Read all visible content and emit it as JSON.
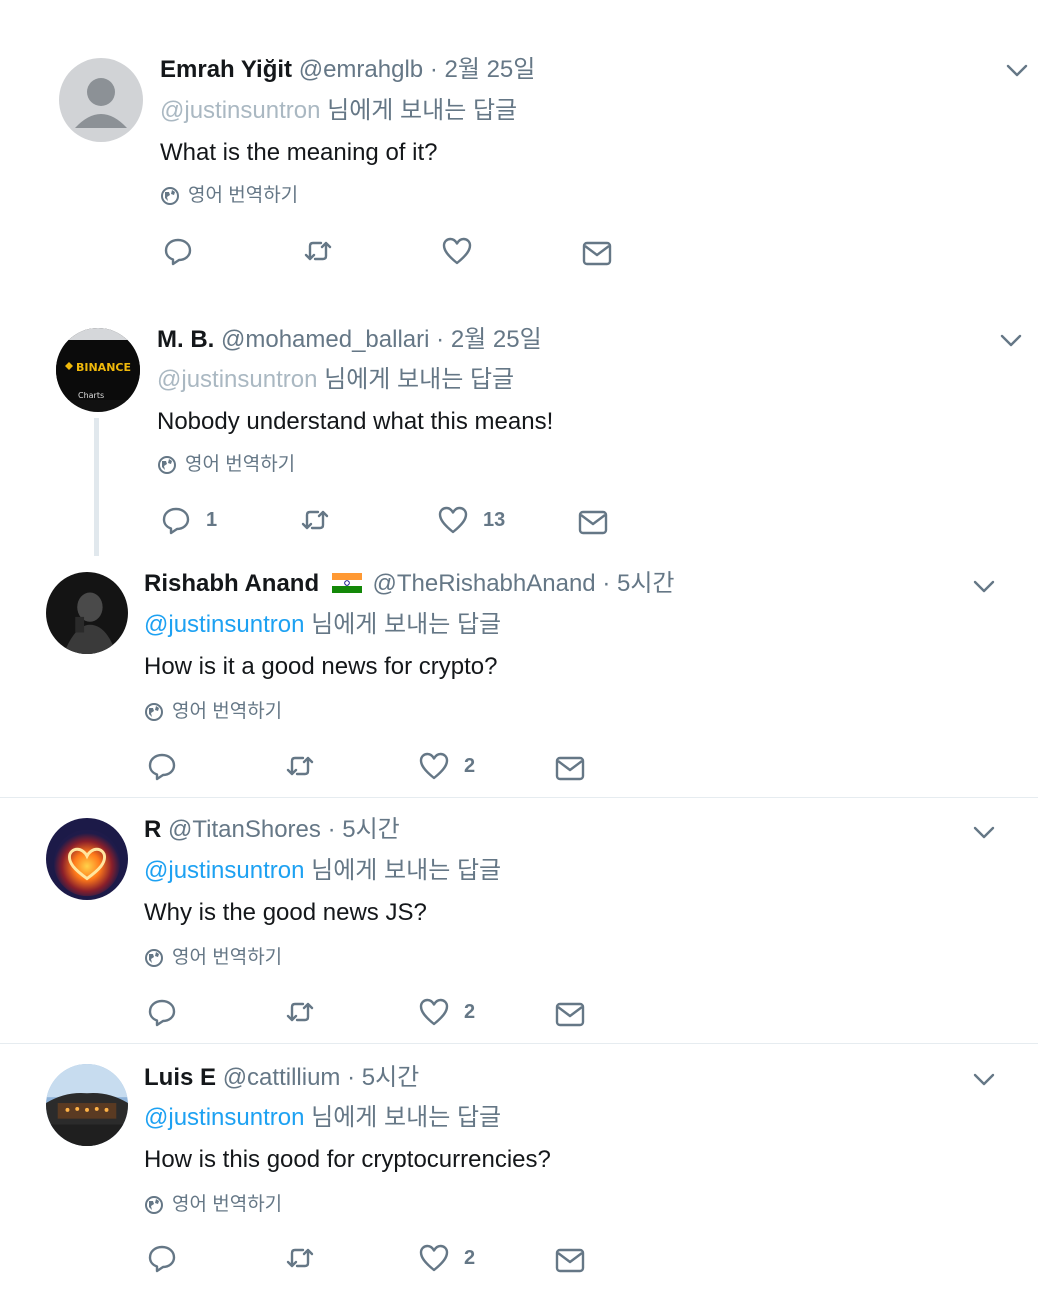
{
  "translate_label": "영어 번역하기",
  "replying_suffix": "님에게 보내는 답글",
  "tweets": [
    {
      "name": "Emrah Yiğit",
      "handle": "@emrahglb",
      "time": "2월 25일",
      "mention": "@justinsuntron",
      "text": "What is the meaning of it?",
      "reply_count": "",
      "like_count": ""
    },
    {
      "name": "M. B.",
      "handle": "@mohamed_ballari",
      "time": "2월 25일",
      "mention": "@justinsuntron",
      "text": "Nobody understand what this means!",
      "avatar_text_1": "BINANCE",
      "avatar_text_2": "Charts",
      "reply_count": "1",
      "like_count": "13"
    },
    {
      "name": "Rishabh Anand",
      "handle": "@TheRishabhAnand",
      "time": "5시간",
      "mention": "@justinsuntron",
      "text": "How is it a good news for crypto?",
      "reply_count": "",
      "like_count": "2"
    },
    {
      "name": "R",
      "handle": "@TitanShores",
      "time": "5시간",
      "mention": "@justinsuntron",
      "text": "Why is the good news JS?",
      "reply_count": "",
      "like_count": "2"
    },
    {
      "name": "Luis E",
      "handle": "@cattillium",
      "time": "5시간",
      "mention": "@justinsuntron",
      "text": "How is this good for cryptocurrencies?",
      "reply_count": "",
      "like_count": "2"
    }
  ],
  "colors": {
    "link": "#1da1f2",
    "secondary": "#657786",
    "faded_mention": "#aab8c2",
    "divider": "#e6ecf0"
  }
}
